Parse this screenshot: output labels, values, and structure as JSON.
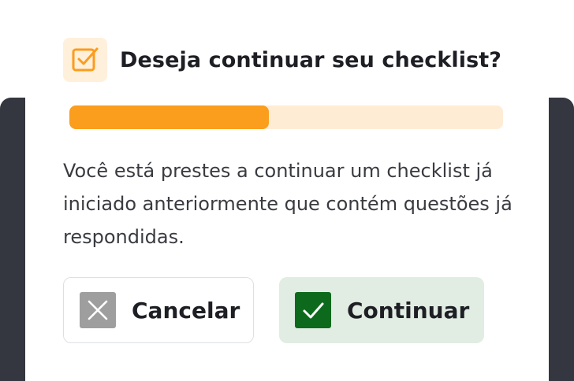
{
  "dialog": {
    "title": "Deseja continuar seu checklist?",
    "header_icon": "checkbox-icon",
    "progress_fraction": 0.46,
    "message": "Você está prestes a continuar um checklist já iniciado anteriormente que contém questões já respondidas.",
    "cancel_label": "Cancelar",
    "cancel_icon": "close-icon",
    "continue_label": "Continuar",
    "continue_icon": "check-icon"
  },
  "colors": {
    "accent": "#FB9D1D",
    "accent_light": "#FFECD4",
    "confirm": "#0D6A1C",
    "confirm_bg": "#E1ECE2",
    "cancel_icon_bg": "#9E9E9E",
    "backdrop": "#34373F"
  }
}
